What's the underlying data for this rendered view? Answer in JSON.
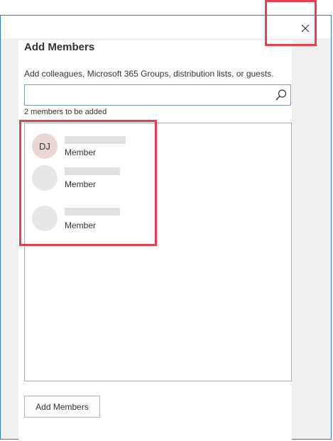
{
  "dialog": {
    "title": "Add Members",
    "subtitle": "Add colleagues, Microsoft 365 Groups, distribution lists, or guests.",
    "search": {
      "value": "",
      "placeholder": ""
    },
    "count_text": "2 members to be added",
    "members": [
      {
        "initials": "DJ",
        "role": "Member"
      },
      {
        "initials": "",
        "role": "Member"
      },
      {
        "initials": "",
        "role": "Member"
      }
    ],
    "add_button_label": "Add Members"
  },
  "colors": {
    "highlight": "#e8404a",
    "window_border": "#2b7ad1"
  },
  "icons": {
    "close": "close-icon",
    "search": "search-icon"
  }
}
